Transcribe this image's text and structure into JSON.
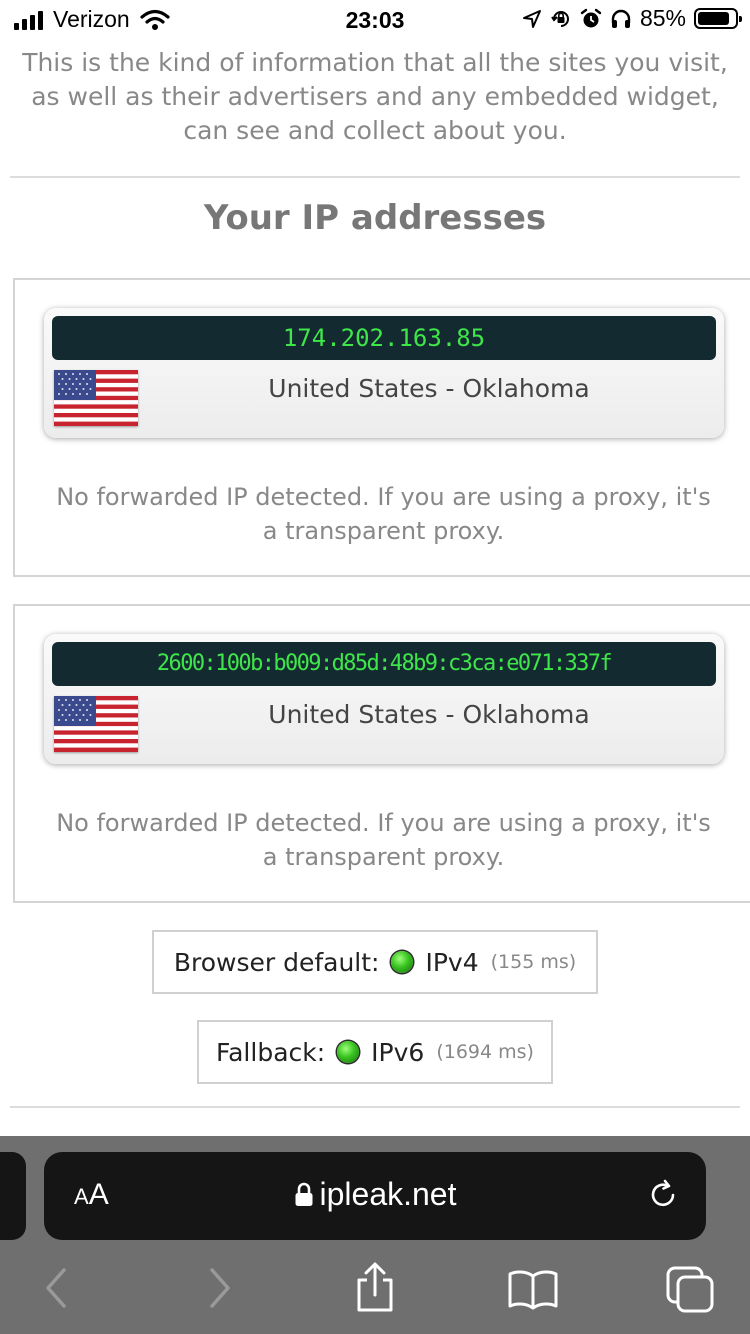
{
  "status_bar": {
    "carrier": "Verizon",
    "time": "23:03",
    "battery_percent": "85%",
    "battery_level": 0.85,
    "icons": [
      "signal-icon",
      "wifi-icon",
      "location-arrow-icon",
      "orientation-lock-icon",
      "alarm-icon",
      "headphones-icon",
      "battery-icon"
    ]
  },
  "page": {
    "intro": "This is the kind of information that all the sites you visit, as well as their advertisers and any embedded widget, can see and collect about you.",
    "section_title": "Your IP addresses",
    "ip_entries": [
      {
        "address": "174.202.163.85",
        "location": "United States - Oklahoma",
        "flag": "us-flag-icon",
        "note": "No forwarded IP detected. If you are using a proxy, it's a transparent proxy."
      },
      {
        "address": "2600:100b:b009:d85d:48b9:c3ca:e071:337f",
        "location": "United States - Oklahoma",
        "flag": "us-flag-icon",
        "note": "No forwarded IP detected. If you are using a proxy, it's a transparent proxy."
      }
    ],
    "browser_default": {
      "label": "Browser default:",
      "protocol": "IPv4",
      "latency": "(155 ms)"
    },
    "fallback": {
      "label": "Fallback:",
      "protocol": "IPv6",
      "latency": "(1694 ms)"
    }
  },
  "browser": {
    "text_size_small": "A",
    "text_size_large": "A",
    "url": "ipleak.net",
    "toolbar": [
      "back-icon",
      "forward-icon",
      "share-icon",
      "bookmarks-icon",
      "tabs-icon"
    ]
  },
  "colors": {
    "ip_display_bg": "#142a31",
    "ip_display_text": "#3ee64a",
    "status_led": "#37c21f",
    "safari_bar": "#6f6f6f"
  }
}
